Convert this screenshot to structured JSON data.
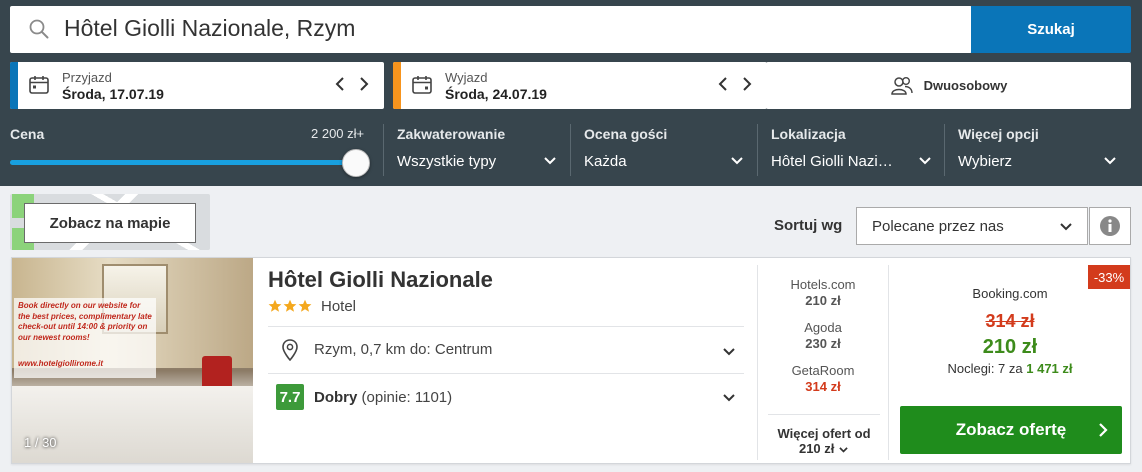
{
  "search": {
    "query": "Hôtel Giolli Nazionale, Rzym",
    "button_label": "Szukaj"
  },
  "checkin": {
    "label": "Przyjazd",
    "value": "Środa, 17.07.19"
  },
  "checkout": {
    "label": "Wyjazd",
    "value": "Środa, 24.07.19"
  },
  "rooms": {
    "label": "Dwuosobowy"
  },
  "filters": {
    "price": {
      "title": "Cena",
      "max": "2 200 zł+",
      "fill_fraction": 1.0
    },
    "accommodation": {
      "title": "Zakwaterowanie",
      "value": "Wszystkie typy"
    },
    "guest_rating": {
      "title": "Ocena gości",
      "value": "Każda"
    },
    "location": {
      "title": "Lokalizacja",
      "value": "Hôtel Giolli Nazi…"
    },
    "more": {
      "title": "Więcej opcji",
      "value": "Wybierz"
    }
  },
  "map_button": "Zobacz na mapie",
  "sort": {
    "label": "Sortuj wg",
    "value": "Polecane przez nas"
  },
  "hotel": {
    "photo_promo": "Book directly on our website for the best prices, complimentary late check-out until 14:00 & priority on our newest rooms!",
    "photo_site": "www.hotelgiollirome.it",
    "photo_counter": "1 / 30",
    "name": "Hôtel Giolli Nazionale",
    "stars": 3,
    "type": "Hotel",
    "location": "Rzym, 0,7 km do: Centrum",
    "rating_score": "7.7",
    "rating_word": "Dobry",
    "rating_count": "(opinie: 1101)",
    "providers": [
      {
        "name": "Hotels.com",
        "price": "210 zł"
      },
      {
        "name": "Agoda",
        "price": "230 zł"
      },
      {
        "name": "GetaRoom",
        "price": "314 zł"
      }
    ],
    "more_offers_label": "Więcej ofert od",
    "more_offers_price": "210 zł",
    "discount": "-33%",
    "main_provider": "Booking.com",
    "old_price": "314 zł",
    "new_price": "210 zł",
    "nights_label": "Noclegi: 7 za",
    "nights_total": "1 471 zł",
    "deal_button": "Zobacz ofertę"
  },
  "colors": {
    "header_bg": "#37454d",
    "primary_blue": "#0a75b8",
    "green": "#1f8c1c",
    "red": "#d33b1c",
    "checkin_accent": "#0a75b8",
    "checkout_accent": "#f7941d"
  }
}
